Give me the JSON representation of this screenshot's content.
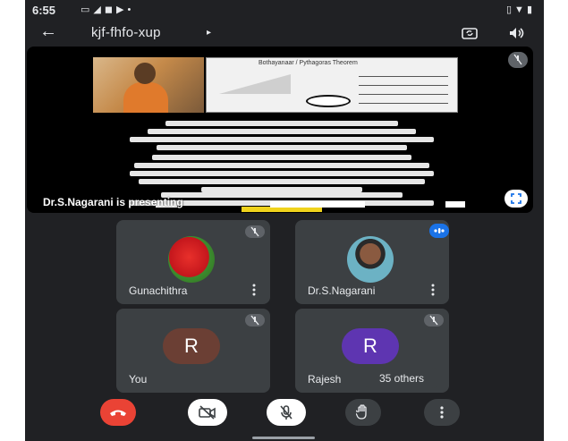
{
  "status_bar": {
    "time": "6:55",
    "notification_icons": [
      "camera-icon",
      "send-icon",
      "s-icon",
      "video-icon",
      "dot-icon"
    ],
    "system_icons": [
      "vibrate-icon",
      "wifi-icon",
      "battery-icon"
    ]
  },
  "header": {
    "meeting_code": "kjf-fhfo-xup",
    "caret": "▸"
  },
  "presentation": {
    "presenter_label": "Dr.S.Nagarani is presenting",
    "slide_title": "Bothayanaar / Pythagoras Theorem"
  },
  "participants": [
    {
      "name": "Gunachithra",
      "avatar": "photo",
      "mic": "muted"
    },
    {
      "name": "Dr.S.Nagarani",
      "avatar": "photo",
      "mic": "speaking"
    },
    {
      "name": "You",
      "avatar_letter": "R",
      "mic": "muted"
    },
    {
      "name": "Rajesh",
      "avatar_letter": "R",
      "mic": "muted"
    }
  ],
  "others_label": "35 others",
  "controls": [
    "end-call",
    "camera-off",
    "mic-off",
    "raise-hand",
    "more-options"
  ],
  "colors": {
    "background": "#202124",
    "tile": "#3c4043",
    "end_call": "#ea4335",
    "speaking": "#1a73e8",
    "you_avatar": "#6b3f34",
    "rajesh_avatar": "#5e35b1"
  }
}
